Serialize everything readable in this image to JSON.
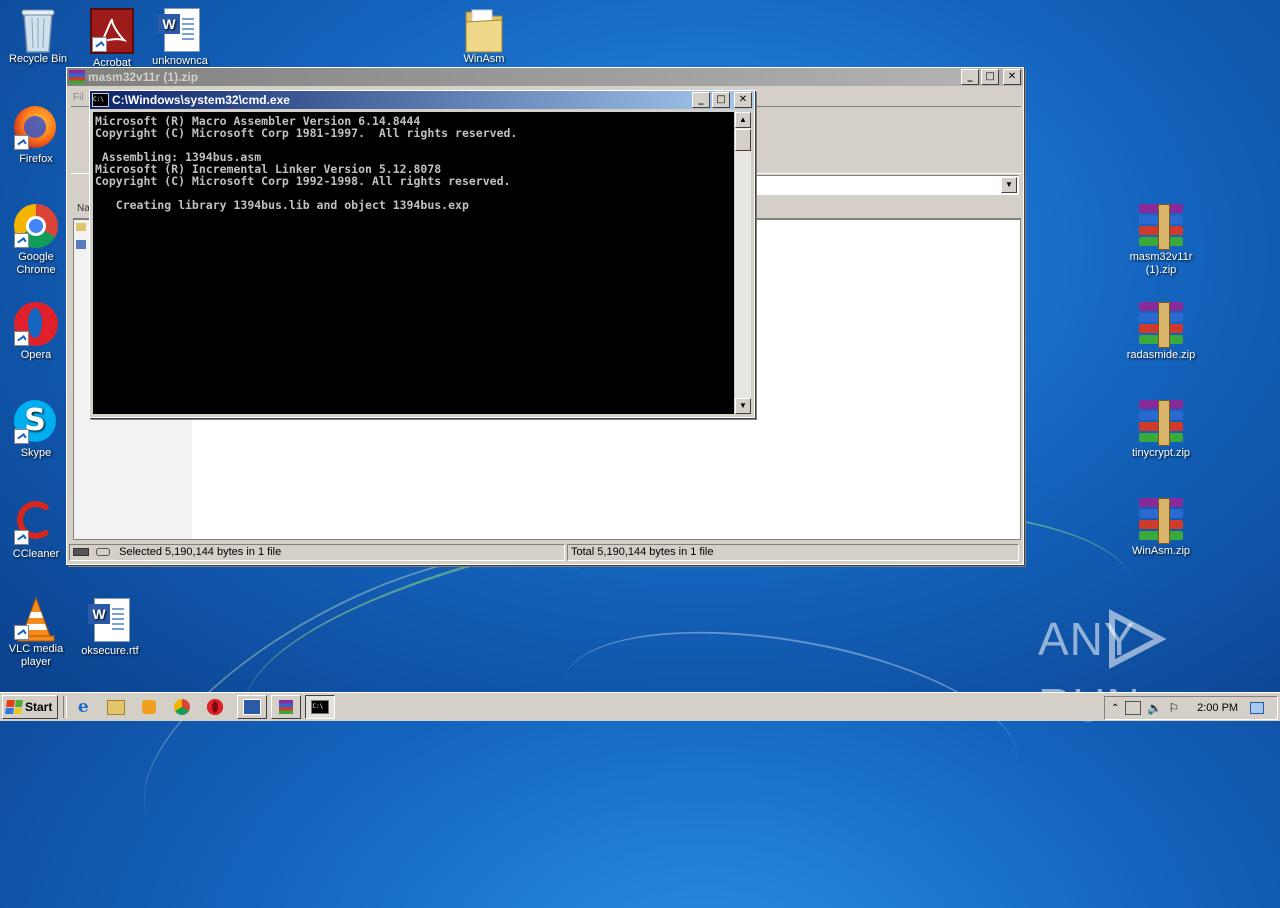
{
  "desktop": {
    "icons_left": [
      {
        "label": "Recycle Bin"
      },
      {
        "label": "Acrobat"
      },
      {
        "label": "unknownca"
      },
      {
        "label": "WinAsm"
      },
      {
        "label": "Firefox"
      },
      {
        "label": "Google Chrome"
      },
      {
        "label": "Opera"
      },
      {
        "label": "Skype"
      },
      {
        "label": "CCleaner"
      },
      {
        "label": "VLC media player"
      },
      {
        "label": "oksecure.rtf"
      }
    ],
    "icons_right": [
      {
        "label": "masm32v11r (1).zip"
      },
      {
        "label": "radasmide.zip"
      },
      {
        "label": "tinycrypt.zip"
      },
      {
        "label": "WinAsm.zip"
      }
    ],
    "watermark": "ANY RUN"
  },
  "winrar": {
    "title": "masm32v11r (1).zip",
    "menu_stub": "Fil",
    "column_stub": "Na",
    "status_left": "Selected 5,190,144 bytes in 1 file",
    "status_right": "Total 5,190,144 bytes in 1 file"
  },
  "cmd": {
    "title": "C:\\Windows\\system32\\cmd.exe",
    "output": "Microsoft (R) Macro Assembler Version 6.14.8444\nCopyright (C) Microsoft Corp 1981-1997.  All rights reserved.\n\n Assembling: 1394bus.asm\nMicrosoft (R) Incremental Linker Version 5.12.8078\nCopyright (C) Microsoft Corp 1992-1998. All rights reserved.\n\n   Creating library 1394bus.lib and object 1394bus.exp"
  },
  "taskbar": {
    "start_label": "Start",
    "clock": "2:00 PM"
  },
  "colors": {
    "console_bg": "#000000",
    "console_fg": "#c0c0c0",
    "active_title": "#0a246a",
    "inactive_title": "#808080",
    "desktop_blue": "#1465c0"
  }
}
